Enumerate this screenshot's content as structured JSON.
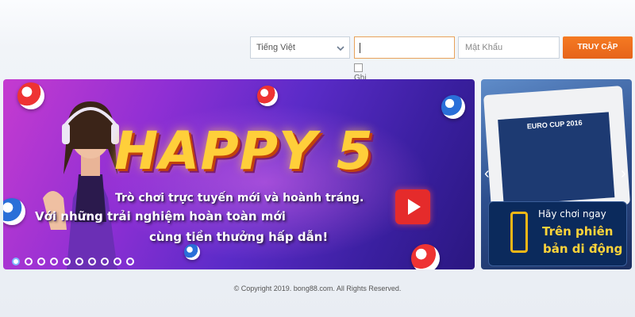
{
  "login": {
    "language": "Tiếng Việt",
    "username_value": "",
    "password_placeholder": "Mật Khẩu",
    "submit_label": "TRUY CẬP",
    "remember_label": "Ghi Nhớ?"
  },
  "banner": {
    "title": "HAPPY 5",
    "subtitle_line1": "Trò chơi trực tuyến mới và hoành tráng.",
    "subtitle_line2": "Với những trải nghiệm hoàn toàn mới",
    "subtitle_line3": "cùng tiền thưởng hấp dẫn!",
    "dots_count": 10,
    "active_dot": 0
  },
  "side_promo": {
    "screen_title": "EURO CUP 2016",
    "cta_line1": "Hãy chơi ngay",
    "cta_line2": "Trên phiên",
    "cta_line3": "bản di động",
    "prev_arrow": "‹",
    "next_arrow": "›"
  },
  "footer": {
    "copyright": "© Copyright 2019. bong88.com. All Rights Reserved."
  },
  "colors": {
    "accent": "#f2701f",
    "banner_bg": "#7a2fd0",
    "title_yellow": "#ffcf3a"
  }
}
